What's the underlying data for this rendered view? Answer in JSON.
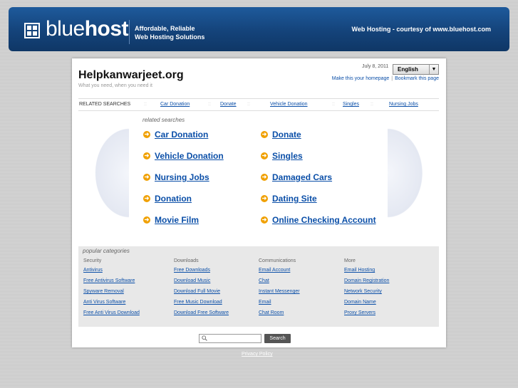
{
  "header": {
    "logo_text_thin": "blue",
    "logo_text_bold": "host",
    "tagline_line1": "Affordable, Reliable",
    "tagline_line2": "Web Hosting Solutions",
    "courtesy": "Web Hosting - courtesy of www.bluehost.com"
  },
  "site": {
    "title": "Helpkanwarjeet.org",
    "subtitle": "What you need, when you need it",
    "date": "July 8, 2011",
    "language": "English",
    "make_homepage": "Make this your homepage",
    "bookmark": "Bookmark this page"
  },
  "related_bar": {
    "label": "RELATED SEARCHES",
    "links": [
      "Car Donation",
      "Donate",
      "Vehicle Donation",
      "Singles",
      "Nursing Jobs"
    ]
  },
  "related_searches": {
    "title": "related searches",
    "left": [
      "Car Donation",
      "Vehicle Donation",
      "Nursing Jobs",
      "Donation",
      "Movie Film"
    ],
    "right": [
      "Donate",
      "Singles",
      "Damaged Cars",
      "Dating Site",
      "Online Checking Account"
    ]
  },
  "popular": {
    "title": "popular categories",
    "columns": [
      {
        "head": "Security",
        "links": [
          "Antivirus",
          "Free Antivirus Software",
          "Spyware Removal",
          "Anti Virus Software",
          "Free Anti Virus Download"
        ]
      },
      {
        "head": "Downloads",
        "links": [
          "Free Downloads",
          "Download Music",
          "Download Full Movie",
          "Free Music Download",
          "Download Free Software"
        ]
      },
      {
        "head": "Communications",
        "links": [
          "Email Account",
          "Chat",
          "Instant Messenger",
          "Email",
          "Chat Room"
        ]
      },
      {
        "head": "More",
        "links": [
          "Email Hosting",
          "Domain Registration",
          "Network Security",
          "Domain Name",
          "Proxy Servers"
        ]
      }
    ]
  },
  "search": {
    "button": "Search",
    "placeholder": ""
  },
  "footer": {
    "privacy": "Privacy Policy"
  },
  "colors": {
    "header_blue": "#1e5a9c",
    "link": "#0b4fa8",
    "bullet": "#f0a000"
  }
}
